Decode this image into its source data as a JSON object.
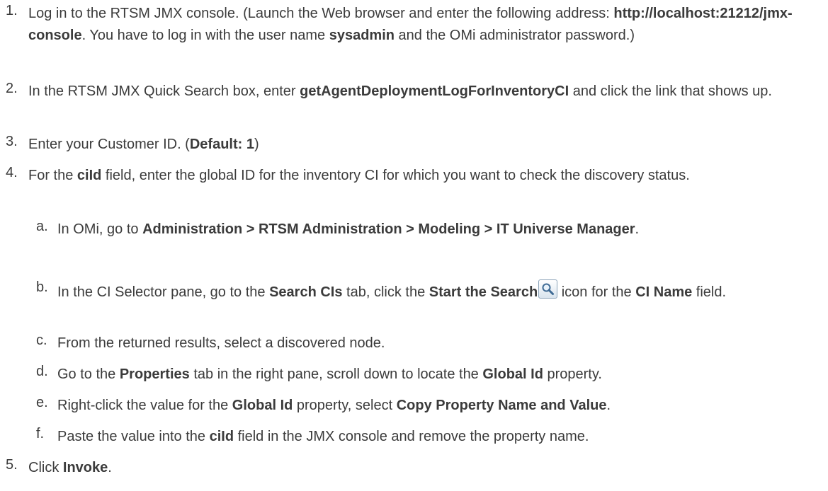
{
  "steps": [
    {
      "num": "1.",
      "t1": "Log in to the RTSM JMX console. (Launch the Web browser and enter the following address: ",
      "b1": "http://localhost:21212/jmx-console",
      "t2": ". You have to log in with the user name ",
      "b2": "sysadmin",
      "t3": " and the OMi administrator password.)"
    },
    {
      "num": "2.",
      "t1": "In the RTSM JMX Quick Search box, enter ",
      "b1": "getAgentDeploymentLogForInventoryCI",
      "t2": " and click the link that shows up."
    },
    {
      "num": "3.",
      "t1": "Enter your Customer ID. (",
      "b1": "Default: 1",
      "t2": ")"
    },
    {
      "num": "4.",
      "t1": "For the ",
      "b1": "ciId",
      "t2": " field, enter the global ID for the inventory CI for which you want to check the discovery status."
    },
    {
      "num": "5.",
      "t1": "Click ",
      "b1": "Invoke",
      "t2": "."
    }
  ],
  "substeps": [
    {
      "num": "a.",
      "t1": "In OMi, go to ",
      "b1": "Administration > RTSM Administration > Modeling > IT Universe Manager",
      "t2": "."
    },
    {
      "num": "b.",
      "t1": "In the CI Selector pane, go to the ",
      "b1": "Search CIs",
      "t2": " tab, click the ",
      "b2": "Start the Search",
      "t3": " icon for the ",
      "b3": "CI Name",
      "t4": " field."
    },
    {
      "num": "c.",
      "t1": "From the returned results, select a discovered node."
    },
    {
      "num": "d.",
      "t1": "Go to the ",
      "b1": "Properties",
      "t2": " tab in the right pane, scroll down to locate the ",
      "b2": "Global Id",
      "t3": " property."
    },
    {
      "num": "e.",
      "t1": "Right-click the value for the ",
      "b1": "Global Id",
      "t2": " property, select ",
      "b2": "Copy Property Name and Value",
      "t3": "."
    },
    {
      "num": "f.",
      "t1": "Paste the value into the ",
      "b1": "ciId",
      "t2": " field in the JMX console and remove the property name."
    }
  ],
  "icons": {
    "search": "magnifier-search-icon"
  }
}
